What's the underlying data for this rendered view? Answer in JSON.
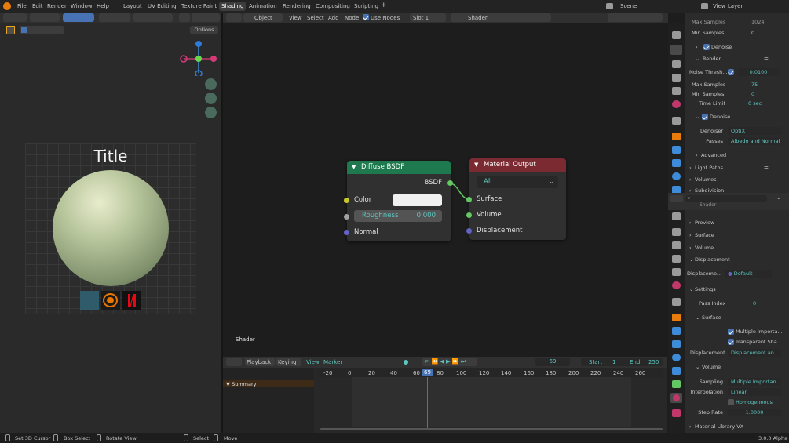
{
  "menu": [
    "File",
    "Edit",
    "Render",
    "Window",
    "Help"
  ],
  "workspaces": [
    "Layout",
    "UV Editing",
    "Texture Paint",
    "Shading",
    "Animation",
    "Rendering",
    "Compositing",
    "Scripting"
  ],
  "active_workspace": "Shading",
  "add_tab": "+",
  "scene": "Scene",
  "view_layer": "View Layer",
  "viewport": {
    "options": "Options",
    "preview_title": "Title"
  },
  "node_editor": {
    "object_mode": "Object",
    "menu": [
      "View",
      "Select",
      "Add",
      "Node"
    ],
    "use_nodes": "Use Nodes",
    "slot": "Slot 1",
    "shader": "Shader",
    "corner_label": "Shader"
  },
  "diffuse_node": {
    "title": "Diffuse BSDF",
    "output": "BSDF",
    "inputs": [
      "Color",
      "Roughness",
      "Normal"
    ],
    "roughness_label": "Roughness",
    "roughness_value": "0.000",
    "header_color": "#1e7a4e"
  },
  "output_node": {
    "title": "Material Output",
    "target": "All",
    "inputs": [
      "Surface",
      "Volume",
      "Displacement"
    ],
    "header_color": "#7a2a30"
  },
  "timeline": {
    "playback": "Playback",
    "keying": "Keying",
    "view": "View",
    "marker": "Marker",
    "current_frame": "69",
    "start_label": "Start",
    "start": "1",
    "end_label": "End",
    "end": "250",
    "summary": "Summary",
    "ruler": [
      "-20",
      "0",
      "20",
      "40",
      "60",
      "69",
      "80",
      "100",
      "120",
      "140",
      "160",
      "180",
      "200",
      "220",
      "240",
      "260"
    ]
  },
  "render_props": {
    "top_rows": [
      {
        "label": "Max Samples",
        "value": "1024"
      },
      {
        "label": "Min Samples",
        "value": "0"
      }
    ],
    "denoise1": "Denoise",
    "render_section": "Render",
    "noise_threshold_label": "Noise Thresh...",
    "noise_threshold": "0.0100",
    "max_samples_label": "Max Samples",
    "max_samples": "75",
    "min_samples_label": "Min Samples",
    "min_samples": "0",
    "time_limit_label": "Time Limit",
    "time_limit": "0 sec",
    "denoise2": "Denoise",
    "denoiser_label": "Denoiser",
    "denoiser": "OptiX",
    "passes_label": "Passes",
    "passes": "Albedo and Normal",
    "advanced": "Advanced",
    "light_paths": "Light Paths",
    "volumes": "Volumes",
    "subdivision": "Subdivision"
  },
  "material_props": {
    "header": "Shader",
    "preview": "Preview",
    "surface": "Surface",
    "volume": "Volume",
    "displacement": "Displacement",
    "displacement_label": "Displaceme...",
    "displacement_value": "Default",
    "settings": "Settings",
    "pass_index_label": "Pass Index",
    "pass_index": "0",
    "surface_sub": "Surface",
    "multiple_importance": "Multiple Importa...",
    "transparent_shadows": "Transparent Sha...",
    "displacement2_label": "Displacement",
    "displacement2_value": "Displacement an...",
    "volume_sub": "Volume",
    "sampling_label": "Sampling",
    "sampling": "Multiple Importan...",
    "interpolation_label": "Interpolation",
    "interpolation": "Linear",
    "homogeneous": "Homogeneous",
    "step_rate_label": "Step Rate",
    "step_rate": "1.0000",
    "material_library": "Material Library VX"
  },
  "status": {
    "set_cursor": "Set 3D Cursor",
    "box_select": "Box Select",
    "rotate_view": "Rotate View",
    "select": "Select",
    "move": "Move",
    "version": "3.0.0 Alpha"
  }
}
